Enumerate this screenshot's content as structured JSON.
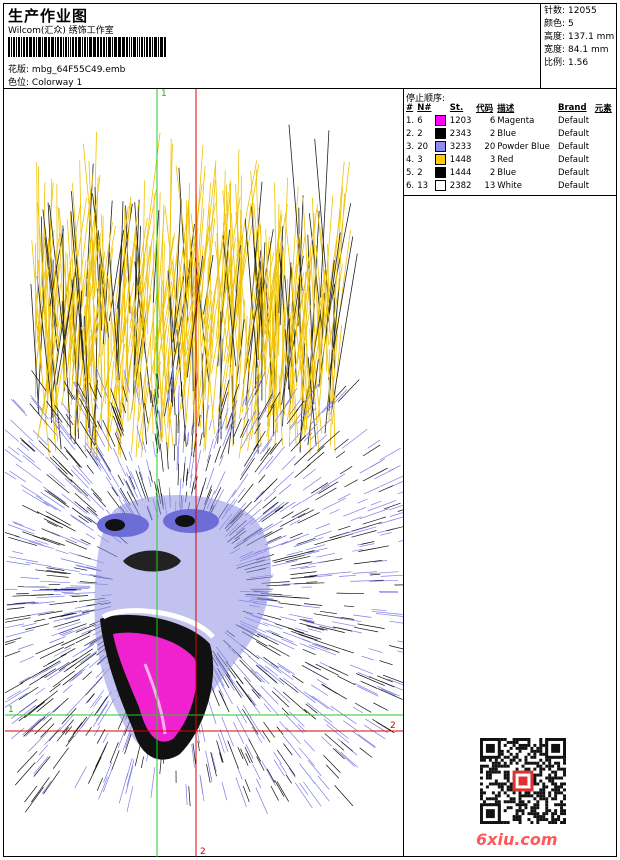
{
  "header": {
    "title": "生产作业图",
    "subtitle": "Wilcom(汇众) 绣饰工作室",
    "design_label": "花版:",
    "design_value": "mbg_64F55C49.emb",
    "colorway_label": "色位:",
    "colorway_value": "Colorway 1"
  },
  "stats": [
    {
      "label": "针数:",
      "value": "12055"
    },
    {
      "label": "颜色:",
      "value": "5"
    },
    {
      "label": "高度:",
      "value": "137.1 mm"
    },
    {
      "label": "宽度:",
      "value": "84.1 mm"
    },
    {
      "label": "比例:",
      "value": "1.56"
    }
  ],
  "stop_sequence": {
    "title": "停止顺序:",
    "columns": [
      "#",
      "N#",
      "St.",
      "代码",
      "描述",
      "Brand",
      "元素"
    ],
    "rows": [
      {
        "idx": "1.",
        "n": "6",
        "color": "#ff00ff",
        "st": "1203",
        "code": "6",
        "desc": "Magenta",
        "brand": "Default"
      },
      {
        "idx": "2.",
        "n": "2",
        "color": "#000000",
        "st": "2343",
        "code": "2",
        "desc": "Blue",
        "brand": "Default"
      },
      {
        "idx": "3.",
        "n": "20",
        "color": "#8c8cf0",
        "st": "3233",
        "code": "20",
        "desc": "Powder Blue",
        "brand": "Default"
      },
      {
        "idx": "4.",
        "n": "3",
        "color": "#ffcc00",
        "st": "1448",
        "code": "3",
        "desc": "Red",
        "brand": "Default"
      },
      {
        "idx": "5.",
        "n": "2",
        "color": "#000000",
        "st": "1444",
        "code": "2",
        "desc": "Blue",
        "brand": "Default"
      },
      {
        "idx": "6.",
        "n": "13",
        "color": "#ffffff",
        "st": "2382",
        "code": "13",
        "desc": "White",
        "brand": "Default"
      }
    ]
  },
  "axes": {
    "green_top": "1",
    "green_left": "1",
    "red_right": "2",
    "red_bottom": "2"
  },
  "watermark": "6xiu.com"
}
